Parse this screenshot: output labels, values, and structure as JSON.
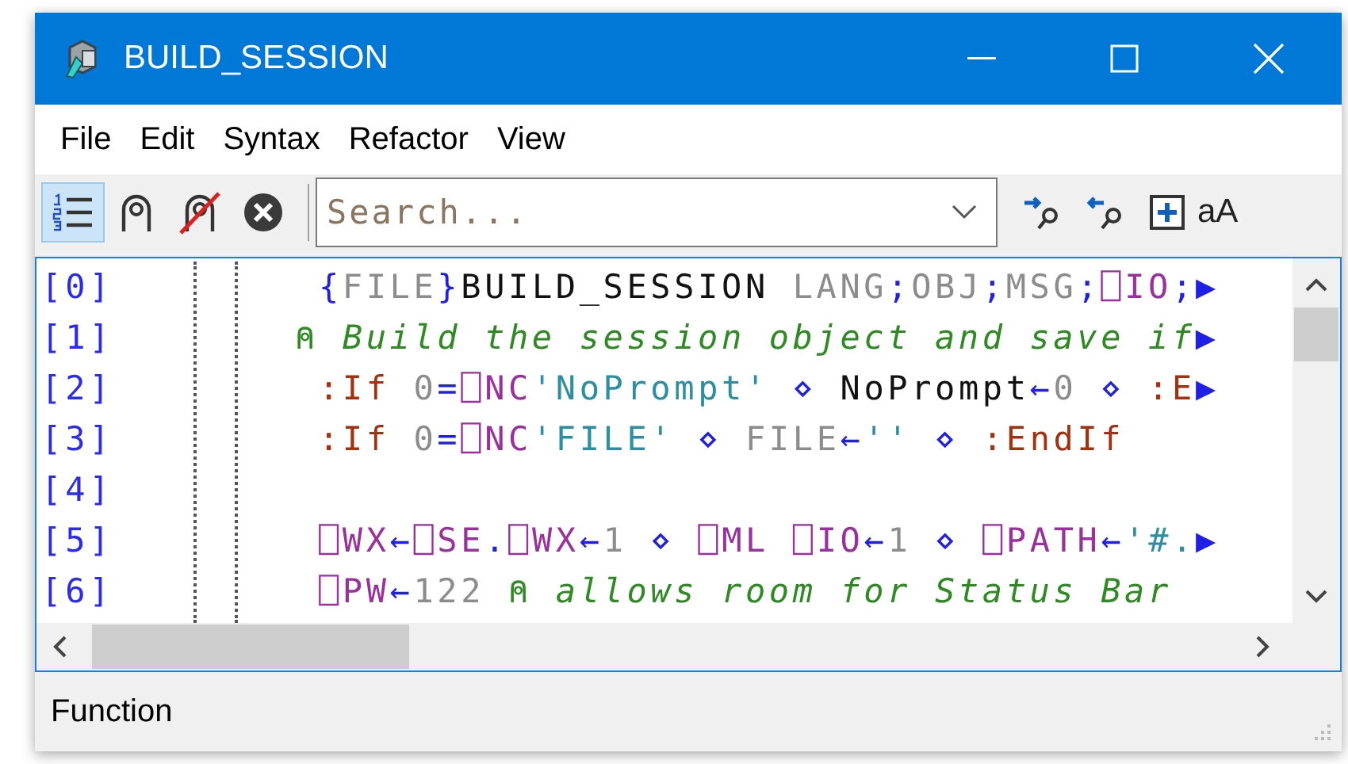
{
  "window": {
    "title": "BUILD_SESSION"
  },
  "menu": [
    {
      "label": "File"
    },
    {
      "label": "Edit"
    },
    {
      "label": "Syntax"
    },
    {
      "label": "Refactor"
    },
    {
      "label": "View"
    }
  ],
  "toolbar": {
    "line_numbers_on": true,
    "search": {
      "placeholder": "Search..."
    },
    "case_toggle": "aA"
  },
  "editor": {
    "lines": [
      {
        "number": "[0]",
        "tokens": [
          {
            "kind": "punct",
            "text": " {"
          },
          {
            "kind": "local",
            "text": "FILE"
          },
          {
            "kind": "punct",
            "text": "}"
          },
          {
            "kind": "name",
            "text": "BUILD_SESSION "
          },
          {
            "kind": "local",
            "text": "LANG"
          },
          {
            "kind": "punct",
            "text": ";"
          },
          {
            "kind": "local",
            "text": "OBJ"
          },
          {
            "kind": "punct",
            "text": ";"
          },
          {
            "kind": "local",
            "text": "MSG"
          },
          {
            "kind": "punct",
            "text": ";"
          },
          {
            "kind": "system",
            "text": "⎕IO"
          },
          {
            "kind": "punct",
            "text": ";▶"
          }
        ]
      },
      {
        "number": "[1]",
        "tokens": [
          {
            "kind": "comment",
            "text": "⍝ Build the session object and save if"
          },
          {
            "kind": "punct",
            "text": "▶"
          }
        ]
      },
      {
        "number": "[2]",
        "tokens": [
          {
            "kind": "keyword",
            "text": " :If "
          },
          {
            "kind": "local",
            "text": "0"
          },
          {
            "kind": "punct",
            "text": "="
          },
          {
            "kind": "system",
            "text": "⎕NC"
          },
          {
            "kind": "string",
            "text": "'NoPrompt'"
          },
          {
            "kind": "punct",
            "text": " ⋄ "
          },
          {
            "kind": "name",
            "text": "NoPrompt"
          },
          {
            "kind": "punct",
            "text": "←"
          },
          {
            "kind": "local",
            "text": "0"
          },
          {
            "kind": "punct",
            "text": " ⋄ "
          },
          {
            "kind": "keyword",
            "text": ":E"
          },
          {
            "kind": "punct",
            "text": "▶"
          }
        ]
      },
      {
        "number": "[3]",
        "tokens": [
          {
            "kind": "keyword",
            "text": " :If "
          },
          {
            "kind": "local",
            "text": "0"
          },
          {
            "kind": "punct",
            "text": "="
          },
          {
            "kind": "system",
            "text": "⎕NC"
          },
          {
            "kind": "string",
            "text": "'FILE'"
          },
          {
            "kind": "punct",
            "text": " ⋄ "
          },
          {
            "kind": "local",
            "text": "FILE"
          },
          {
            "kind": "punct",
            "text": "←"
          },
          {
            "kind": "string",
            "text": "''"
          },
          {
            "kind": "punct",
            "text": " ⋄ "
          },
          {
            "kind": "keyword",
            "text": ":EndIf"
          }
        ]
      },
      {
        "number": "[4]"
      },
      {
        "number": "[5]",
        "tokens": [
          {
            "kind": "system",
            "text": " ⎕WX"
          },
          {
            "kind": "punct",
            "text": "←"
          },
          {
            "kind": "system",
            "text": "⎕SE"
          },
          {
            "kind": "punct",
            "text": "."
          },
          {
            "kind": "system",
            "text": "⎕WX"
          },
          {
            "kind": "punct",
            "text": "←"
          },
          {
            "kind": "local",
            "text": "1"
          },
          {
            "kind": "punct",
            "text": " ⋄ "
          },
          {
            "kind": "system",
            "text": "⎕ML ⎕IO"
          },
          {
            "kind": "punct",
            "text": "←"
          },
          {
            "kind": "local",
            "text": "1"
          },
          {
            "kind": "punct",
            "text": " ⋄ "
          },
          {
            "kind": "system",
            "text": "⎕PATH"
          },
          {
            "kind": "punct",
            "text": "←"
          },
          {
            "kind": "string",
            "text": "'#."
          },
          {
            "kind": "punct",
            "text": "▶"
          }
        ]
      },
      {
        "number": "[6]",
        "tokens": [
          {
            "kind": "system",
            "text": " ⎕PW"
          },
          {
            "kind": "punct",
            "text": "←"
          },
          {
            "kind": "local",
            "text": "122 "
          },
          {
            "kind": "comment",
            "text": "⍝ allows room for Status Bar"
          }
        ]
      }
    ]
  },
  "status_bar": {
    "text": "Function"
  }
}
